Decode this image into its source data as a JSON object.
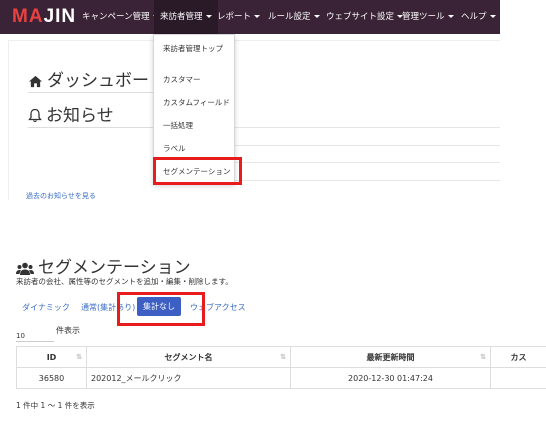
{
  "top": {
    "logo": {
      "part1": "MA",
      "part2": "JIN"
    },
    "nav": [
      {
        "label": "キャンペーン管理"
      },
      {
        "label": "来訪者管理"
      },
      {
        "label": "レポート"
      },
      {
        "label": "ルール設定"
      },
      {
        "label": "ウェブサイト設定"
      },
      {
        "label": "管理ツール"
      },
      {
        "label": "ヘルプ"
      }
    ],
    "dashboard_title": "ダッシュボード",
    "notice_title": "お知らせ",
    "past_notices_link": "過去のお知らせを見る",
    "dropdown": [
      {
        "label": "来訪者管理トップ"
      },
      {
        "label": "カスタマー"
      },
      {
        "label": "カスタムフィールド"
      },
      {
        "label": "一括処理"
      },
      {
        "label": "ラベル"
      },
      {
        "label": "セグメンテーション"
      }
    ]
  },
  "seg": {
    "title": "セグメンテーション",
    "description": "来訪者の会社、属性等のセグメントを追加・編集・削除します。",
    "tabs": [
      {
        "label": "ダイナミック"
      },
      {
        "label": "通常(集計あり)"
      },
      {
        "label": "集計なし"
      },
      {
        "label": "ウェブアクセス"
      }
    ],
    "page_size_value": "10",
    "page_size_label": "件表示",
    "columns": [
      {
        "label": "ID"
      },
      {
        "label": "セグメント名"
      },
      {
        "label": "最新更新時間"
      },
      {
        "label": "カス"
      }
    ],
    "rows": [
      {
        "id": "36580",
        "name": "202012_メールクリック",
        "updated": "2020-12-30 01:47:24",
        "extra": ""
      }
    ],
    "table_info": "1 件中 1 ～ 1 件を表示"
  },
  "colors": {
    "navbar": "#3a2337",
    "logo_red": "#e8423f",
    "link": "#3a6cc6",
    "active_tab": "#3d5fc4",
    "highlight_box": "#e81c1c"
  },
  "icons": [
    "home-icon",
    "bell-icon",
    "users-icon",
    "sort-icon"
  ]
}
